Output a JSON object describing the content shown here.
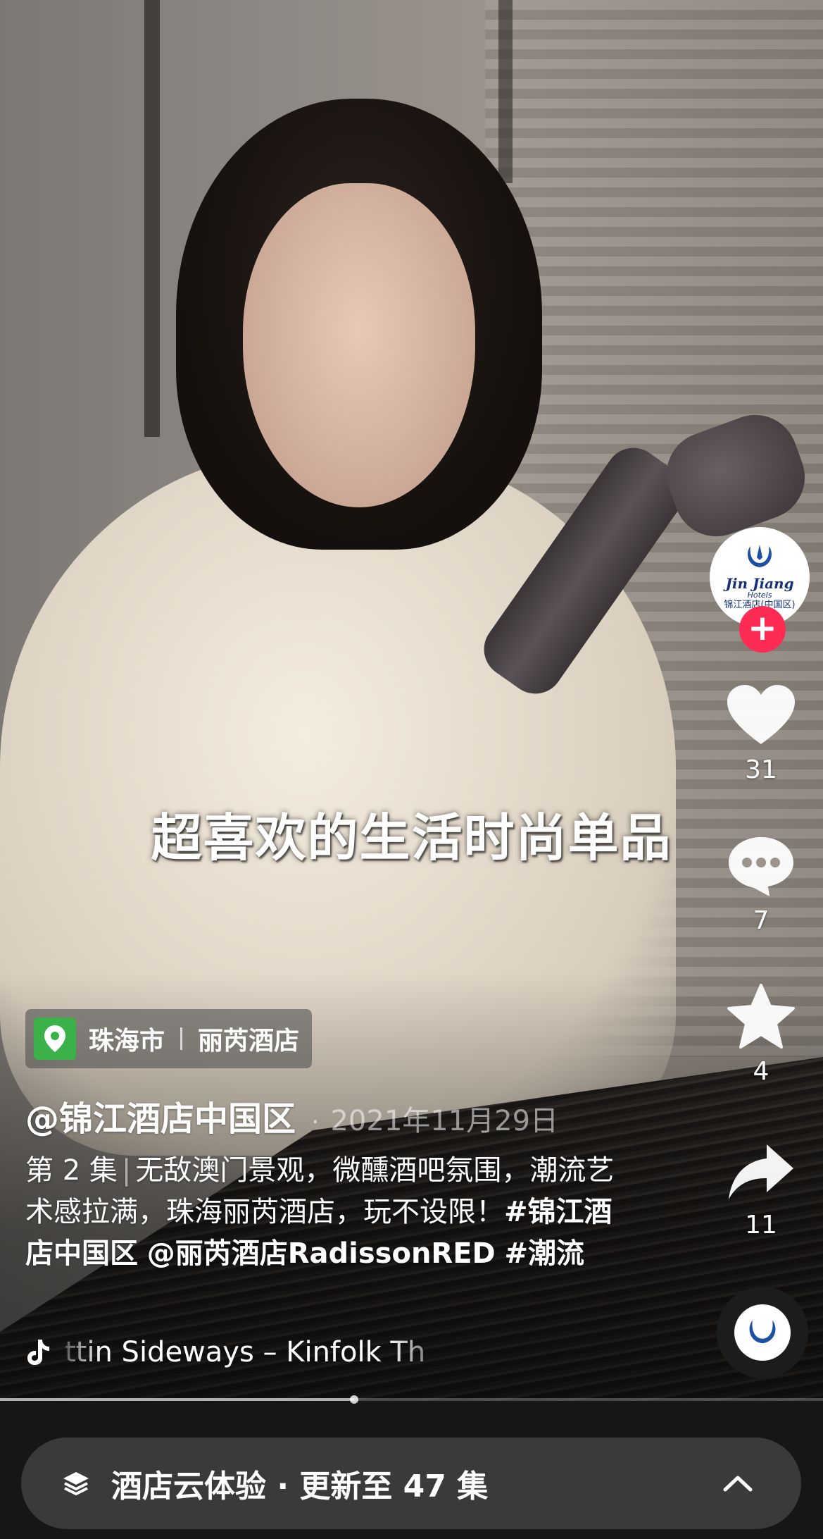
{
  "video": {
    "subtitle": "超喜欢的生活时尚单品",
    "progress": 0.43
  },
  "rail": {
    "avatar": {
      "brand": "Jin Jiang",
      "brand_sub": "Hotels",
      "brand_cn": "锦江酒店(中国区)"
    },
    "follow_icon": "plus-icon",
    "likes": "31",
    "comments": "7",
    "favorites": "4",
    "shares": "11"
  },
  "location": {
    "city": "珠海市",
    "place": "丽芮酒店"
  },
  "author": {
    "name": "@锦江酒店中国区",
    "date": "2021年11月29日"
  },
  "description": {
    "episode": "第 2 集",
    "text": "无敌澳门景观，微醺酒吧氛围，潮流艺术感拉满，珠海丽芮酒店，玩不设限！",
    "tags": [
      "#锦江酒店中国区",
      "@丽芮酒店RadissonRED",
      "#潮流"
    ]
  },
  "music": {
    "title": "ttin Sideways – Kinfolk Th"
  },
  "series": {
    "label": "酒店云体验 · 更新至 47 集"
  },
  "colors": {
    "follow_red": "#fe2c55",
    "location_green": "#3bb14a",
    "series_bar": "#3a3a3a"
  }
}
